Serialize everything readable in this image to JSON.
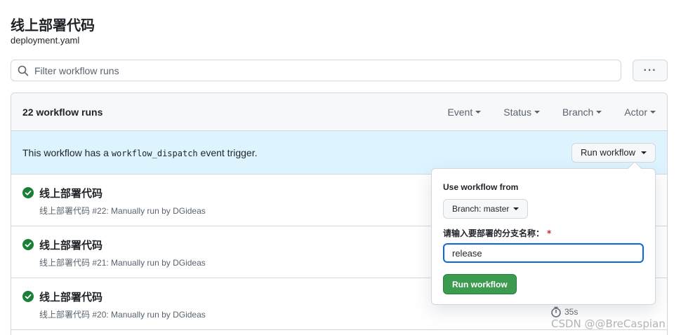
{
  "page": {
    "title": "线上部署代码",
    "subtitle": "deployment.yaml"
  },
  "search": {
    "placeholder": "Filter workflow runs",
    "value": ""
  },
  "more_button": {
    "label": "···"
  },
  "runs_header": {
    "count_text": "22 workflow runs",
    "filters": [
      {
        "label": "Event"
      },
      {
        "label": "Status"
      },
      {
        "label": "Branch"
      },
      {
        "label": "Actor"
      }
    ]
  },
  "dispatch_banner": {
    "text_before": "This workflow has a ",
    "code": "workflow_dispatch",
    "text_after": " event trigger.",
    "button_label": "Run workflow"
  },
  "runs": [
    {
      "title": "线上部署代码",
      "workflow": "线上部署代码",
      "detail": " #22: Manually run by DGideas",
      "status": "success"
    },
    {
      "title": "线上部署代码",
      "workflow": "线上部署代码",
      "detail": " #21: Manually run by DGideas",
      "status": "success"
    },
    {
      "title": "线上部署代码",
      "workflow": "线上部署代码",
      "detail": " #20: Manually run by DGideas",
      "status": "success",
      "duration": "35s"
    }
  ],
  "popover": {
    "use_workflow_label": "Use workflow from",
    "branch_button_label": "Branch: master",
    "input_label": "请输入要部署的分支名称：",
    "required_mark": "*",
    "input_value": "release",
    "submit_label": "Run workflow"
  },
  "watermark": "CSDN @@BreCaspian",
  "colors": {
    "accent_blue": "#0969da",
    "success_green": "#1a7f37",
    "button_green": "#3d9b4f",
    "banner_bg": "#ddf4ff",
    "required_red": "#d1242f"
  }
}
